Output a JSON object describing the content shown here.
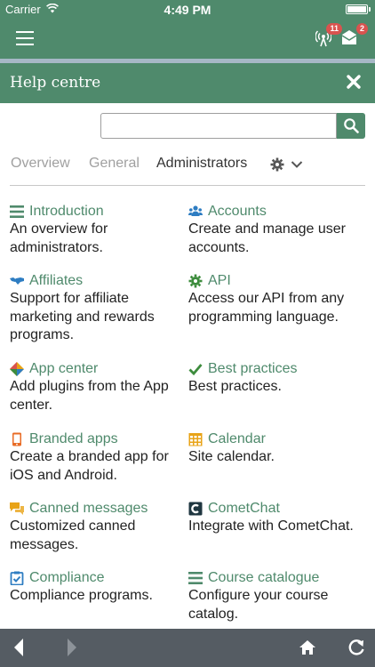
{
  "status": {
    "carrier": "Carrier",
    "time": "4:49 PM"
  },
  "toolbar": {
    "radio_badge": "11",
    "mail_badge": "2"
  },
  "help": {
    "title": "Help centre",
    "search_placeholder": ""
  },
  "tabs": [
    {
      "label": "Overview",
      "active": false
    },
    {
      "label": "General",
      "active": false
    },
    {
      "label": "Administrators",
      "active": true
    }
  ],
  "topics": [
    {
      "label": "Introduction",
      "desc": "An overview for administrators.",
      "icon": "list-icon"
    },
    {
      "label": "Accounts",
      "desc": "Create and manage user accounts.",
      "icon": "users-icon"
    },
    {
      "label": "Affiliates",
      "desc": "Support for affiliate marketing and rewards programs.",
      "icon": "handshake-icon"
    },
    {
      "label": "API",
      "desc": "Access our API from any programming language.",
      "icon": "cog-icon"
    },
    {
      "label": "App center",
      "desc": "Add plugins from the App center.",
      "icon": "app-center-icon"
    },
    {
      "label": "Best practices",
      "desc": "Best practices.",
      "icon": "check-icon"
    },
    {
      "label": "Branded apps",
      "desc": "Create a branded app for iOS and Android.",
      "icon": "mobile-icon"
    },
    {
      "label": "Calendar",
      "desc": "Site calendar.",
      "icon": "calendar-icon"
    },
    {
      "label": "Canned messages",
      "desc": "Customized canned messages.",
      "icon": "chat-icon"
    },
    {
      "label": "CometChat",
      "desc": "Integrate with CometChat.",
      "icon": "cometchat-icon"
    },
    {
      "label": "Compliance",
      "desc": "Compliance programs.",
      "icon": "clipboard-check-icon"
    },
    {
      "label": "Course catalogue",
      "desc": "Configure your course catalog.",
      "icon": "list-icon"
    }
  ],
  "colors": {
    "brand": "#4f8a6c",
    "bottom_bar": "#555c63",
    "badge": "#d9534f"
  }
}
